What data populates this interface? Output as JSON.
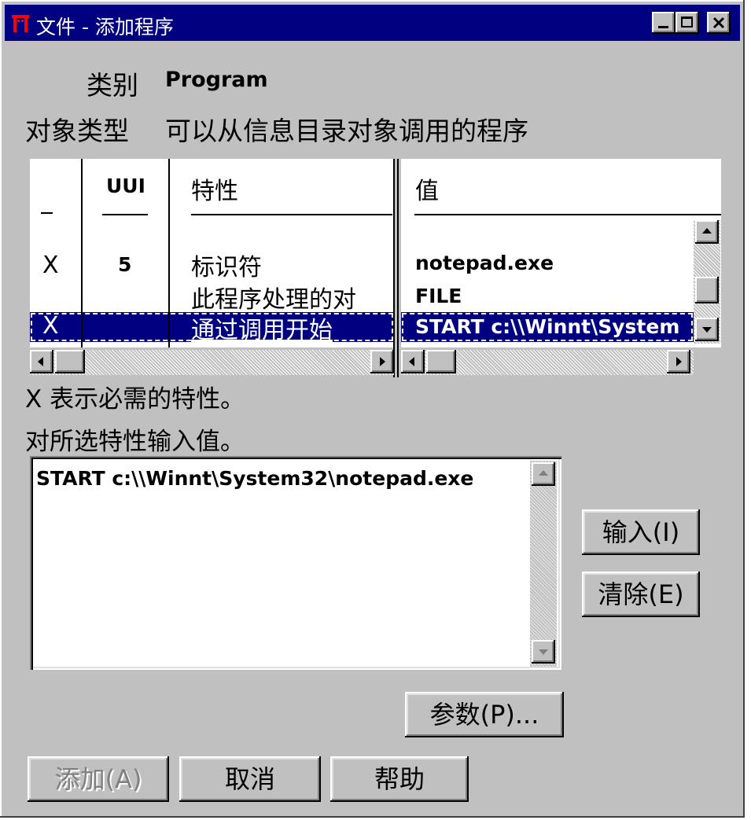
{
  "window": {
    "title": "文件 - 添加程序",
    "controls": {
      "minimize": "minimize-icon",
      "maximize": "maximize-icon",
      "close": "close-icon"
    }
  },
  "category": {
    "label": "类别",
    "value": "Program"
  },
  "object_type": {
    "label": "对象类型",
    "value": "可以从信息目录对象调用的程序"
  },
  "table": {
    "headers": {
      "required": "_",
      "uui": "UUI",
      "property": "特性",
      "value": "值"
    },
    "rows": [
      {
        "required": "X",
        "uui": "5",
        "property": "标识符",
        "value": "notepad.exe",
        "selected": false
      },
      {
        "required": "",
        "uui": "",
        "property": "此程序处理的对",
        "value": "FILE",
        "selected": false
      },
      {
        "required": "X",
        "uui": "",
        "property": "通过调用开始",
        "value": "START c:\\\\Winnt\\System",
        "selected": true
      }
    ]
  },
  "required_note": "X 表示必需的特性。",
  "input_label": "对所选特性输入值。",
  "input_value": "START c:\\\\Winnt\\System32\\notepad.exe",
  "buttons": {
    "enter": "输入(I)",
    "clear": "清除(E)",
    "params": "参数(P)...",
    "add": "添加(A)",
    "cancel": "取消",
    "help": "帮助"
  },
  "colors": {
    "titlebar": "#000080",
    "face": "#c0c0c0",
    "selection": "#000080"
  }
}
